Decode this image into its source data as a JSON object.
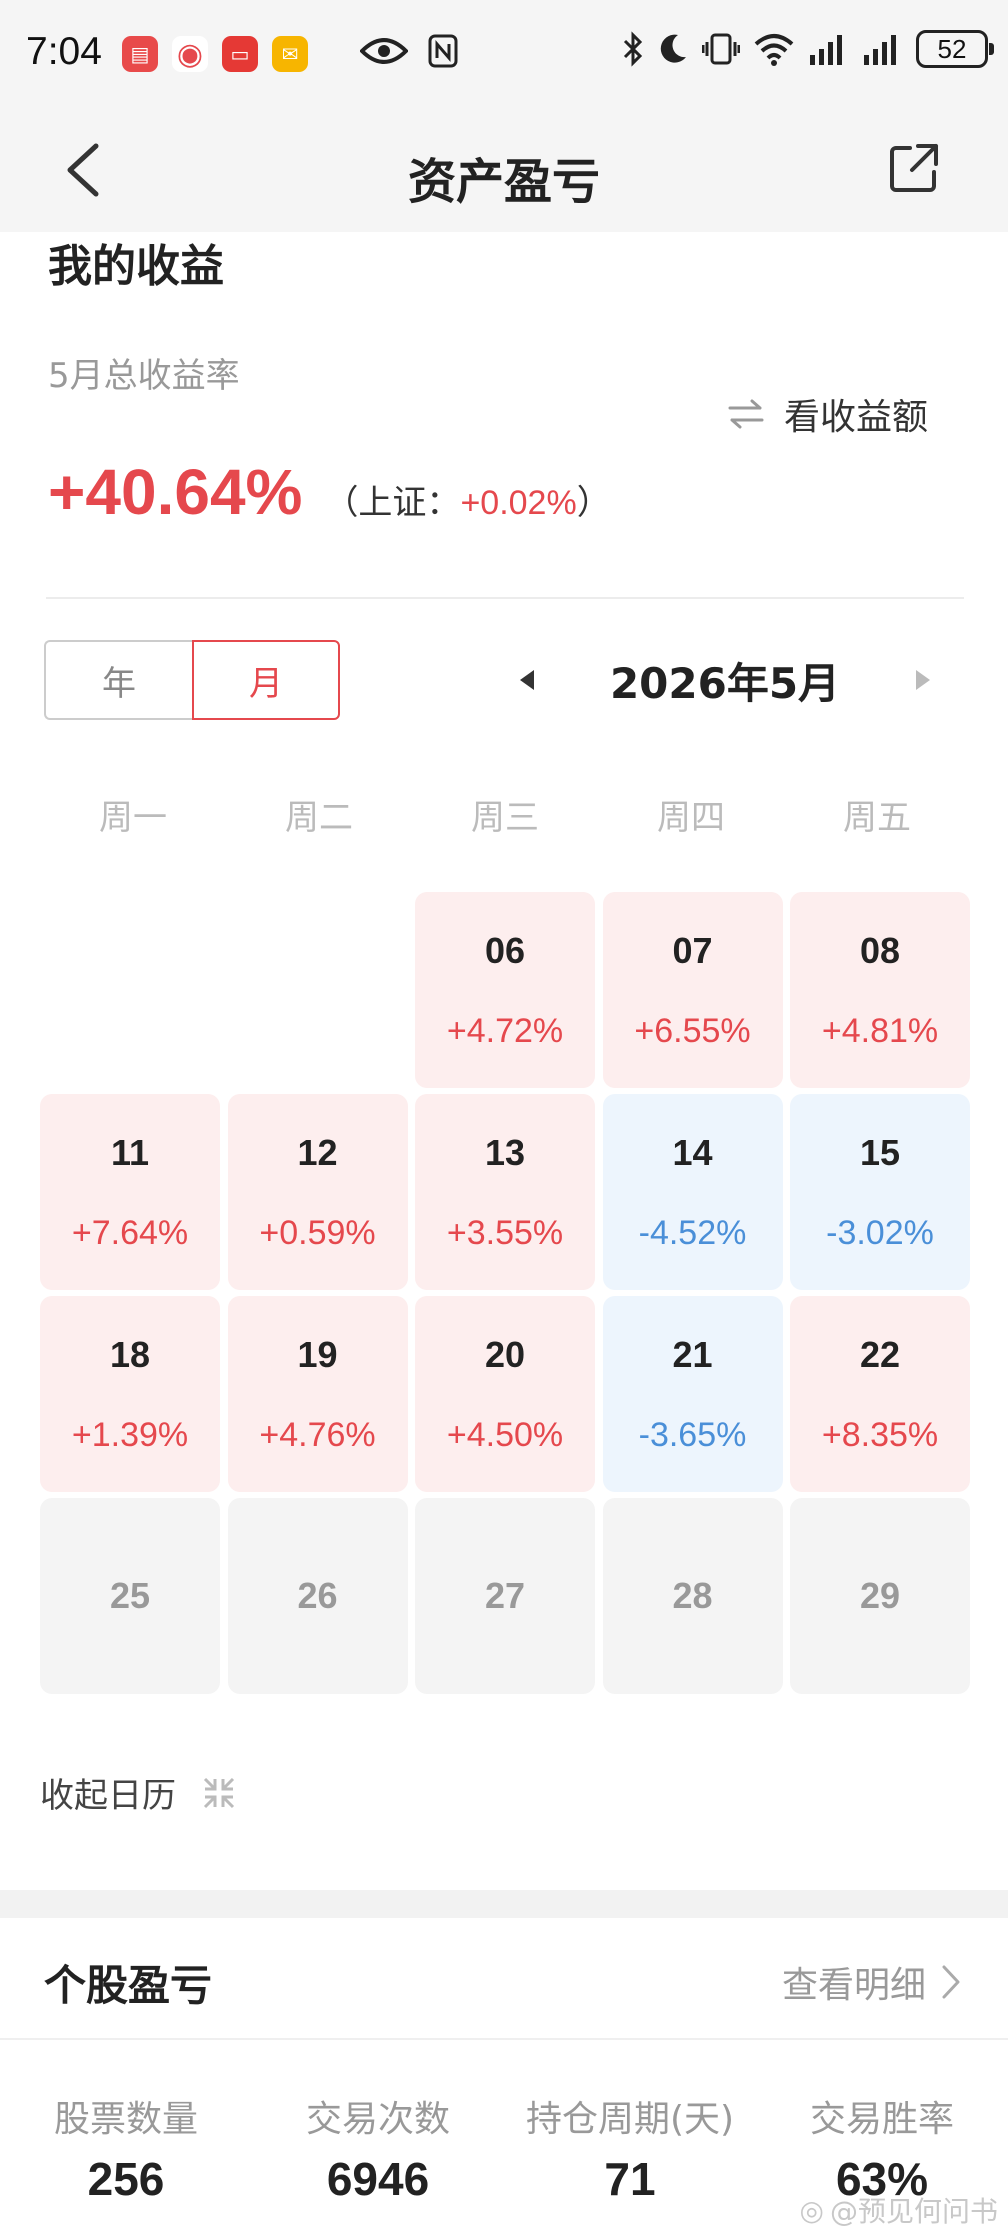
{
  "status_bar": {
    "time": "7:04",
    "battery": "52",
    "app_icons": [
      "note-app-icon",
      "weibo-icon",
      "video-app-icon",
      "mail-icon"
    ],
    "indicators": [
      "eye-icon",
      "nfc-icon",
      "bluetooth-icon",
      "moon-icon",
      "vibrate-icon",
      "wifi-icon",
      "signal-icon",
      "signal-icon"
    ]
  },
  "nav": {
    "title": "资产盈亏"
  },
  "earnings": {
    "section_title": "我的收益",
    "rate_label": "5月总收益率",
    "toggle_label": "看收益额",
    "rate_value": "+40.64%",
    "benchmark_prefix": "（上证：",
    "benchmark_value": "+0.02%",
    "benchmark_suffix": "）"
  },
  "period": {
    "tabs": [
      "年",
      "月"
    ],
    "active_tab": "月",
    "month_label": "2026年5月"
  },
  "calendar": {
    "weekdays": [
      "周一",
      "周二",
      "周三",
      "周四",
      "周五"
    ],
    "cells": [
      {
        "day": "",
        "pct": "",
        "state": "empty"
      },
      {
        "day": "",
        "pct": "",
        "state": "empty"
      },
      {
        "day": "06",
        "pct": "+4.72%",
        "state": "up"
      },
      {
        "day": "07",
        "pct": "+6.55%",
        "state": "up"
      },
      {
        "day": "08",
        "pct": "+4.81%",
        "state": "up"
      },
      {
        "day": "11",
        "pct": "+7.64%",
        "state": "up"
      },
      {
        "day": "12",
        "pct": "+0.59%",
        "state": "up"
      },
      {
        "day": "13",
        "pct": "+3.55%",
        "state": "up"
      },
      {
        "day": "14",
        "pct": "-4.52%",
        "state": "down"
      },
      {
        "day": "15",
        "pct": "-3.02%",
        "state": "down"
      },
      {
        "day": "18",
        "pct": "+1.39%",
        "state": "up"
      },
      {
        "day": "19",
        "pct": "+4.76%",
        "state": "up"
      },
      {
        "day": "20",
        "pct": "+4.50%",
        "state": "up"
      },
      {
        "day": "21",
        "pct": "-3.65%",
        "state": "down"
      },
      {
        "day": "22",
        "pct": "+8.35%",
        "state": "up"
      },
      {
        "day": "25",
        "pct": "",
        "state": "none"
      },
      {
        "day": "26",
        "pct": "",
        "state": "none"
      },
      {
        "day": "27",
        "pct": "",
        "state": "none"
      },
      {
        "day": "28",
        "pct": "",
        "state": "none"
      },
      {
        "day": "29",
        "pct": "",
        "state": "none"
      }
    ],
    "collapse_label": "收起日历"
  },
  "stock_pnl": {
    "title": "个股盈亏",
    "detail_label": "查看明细",
    "stats": [
      {
        "label": "股票数量",
        "value": "256"
      },
      {
        "label": "交易次数",
        "value": "6946"
      },
      {
        "label": "持仓周期(天)",
        "value": "71"
      },
      {
        "label": "交易胜率",
        "value": "63%"
      }
    ]
  },
  "watermark": "@预见何问书",
  "colors": {
    "gain": "#e5484d",
    "loss": "#4a8fd8",
    "gain_bg": "#fdeeee",
    "loss_bg": "#edf5fd",
    "neutral_bg": "#f4f4f4"
  }
}
